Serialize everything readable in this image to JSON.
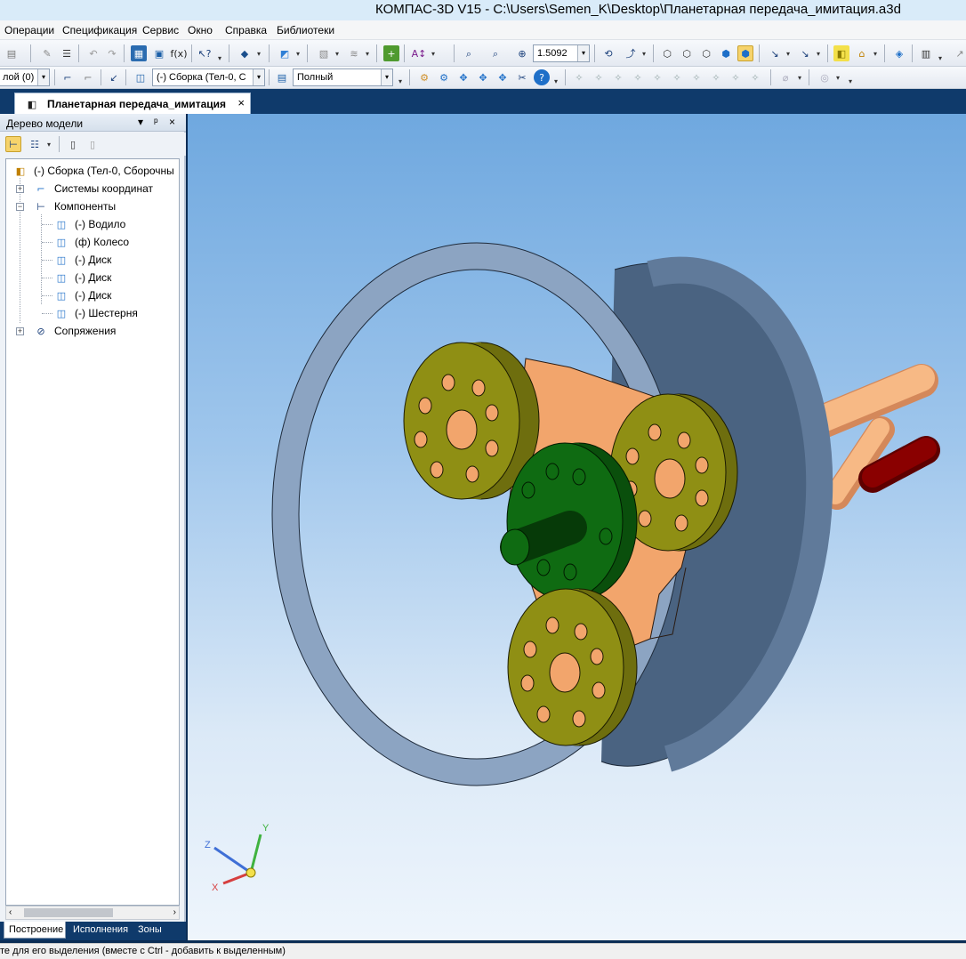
{
  "app": {
    "title": "КОМПАС-3D V15 - C:\\Users\\Semen_K\\Desktop\\Планетарная передача_имитация.a3d"
  },
  "menu": {
    "items": [
      "Операции",
      "Спецификация",
      "Сервис",
      "Окно",
      "Справка",
      "Библиотеки"
    ]
  },
  "toolbar": {
    "zoom_value": "1.5092",
    "layer_label": "лой (0)",
    "component_combo": "(-) Сборка (Тел-0, С",
    "display_mode": "Полный"
  },
  "document_tab": {
    "label": "Планетарная передача_имитация",
    "close": "×"
  },
  "panel": {
    "title": "Дерево модели",
    "pin": "ᵖ",
    "menu_arrow": "▾",
    "close": "×"
  },
  "tree": {
    "root": "(-) Сборка (Тел-0, Сборочны",
    "coords": "Системы координат",
    "components": "Компоненты",
    "children": [
      "(-) Водило",
      "(ф) Колесо",
      "(-) Диск",
      "(-) Диск",
      "(-) Диск",
      "(-) Шестерня"
    ],
    "mates": "Сопряжения"
  },
  "bottom_tabs": [
    "Построение",
    "Исполнения",
    "Зоны"
  ],
  "axes": {
    "x": "X",
    "y": "Y",
    "z": "Z"
  },
  "status": {
    "text": "те для его выделения (вместе с Ctrl - добавить к выделенным)"
  },
  "colors": {
    "ring": "#8ca4c2",
    "disk": "#8f8f14",
    "carrier": "#f2a56c",
    "sun_gear": "#0f6b12",
    "shaft_red": "#8a0000",
    "viewport_top": "#6fa8df",
    "viewport_bottom": "#eef5fc"
  }
}
